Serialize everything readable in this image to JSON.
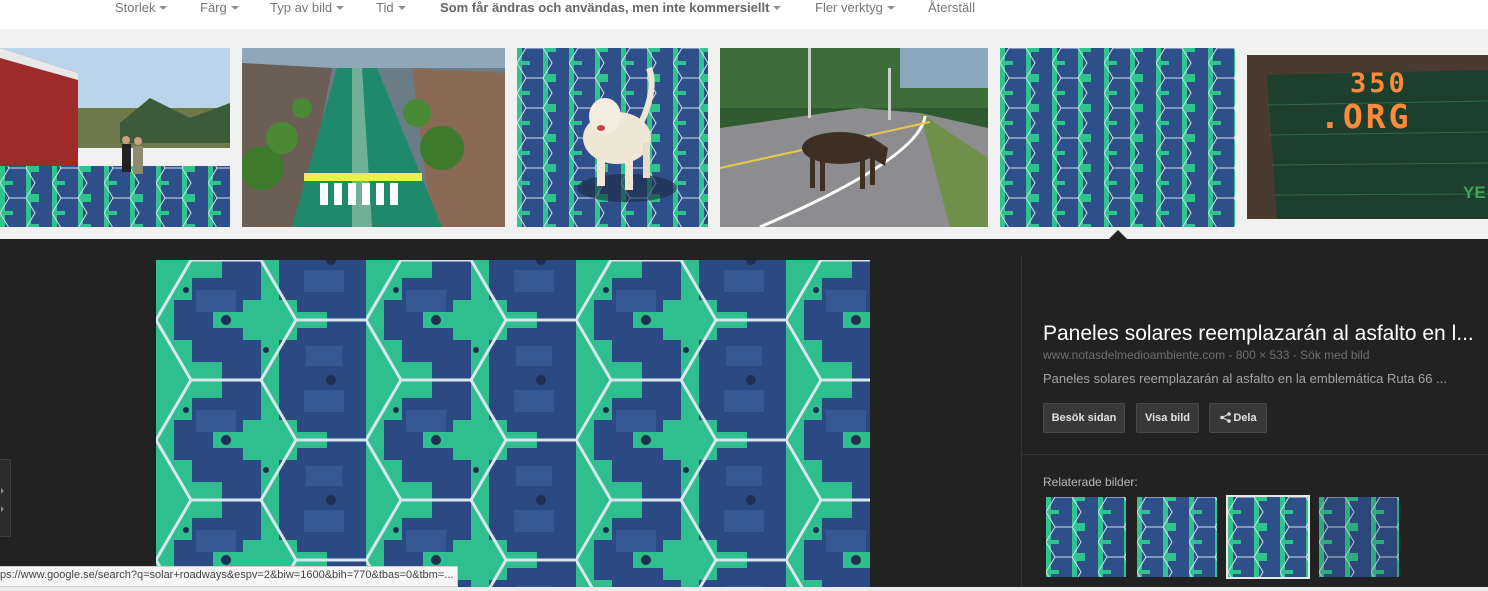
{
  "toolbar": {
    "tools": [
      {
        "label": "Storlek",
        "dropdown": true
      },
      {
        "label": "Färg",
        "dropdown": true
      },
      {
        "label": "Typ av bild",
        "dropdown": true
      },
      {
        "label": "Tid",
        "dropdown": true
      },
      {
        "label": "Som får ändras och användas, men inte kommersiellt",
        "dropdown": true,
        "bold": true
      },
      {
        "label": "Fler verktyg",
        "dropdown": true
      },
      {
        "label": "Återställ",
        "dropdown": false
      }
    ]
  },
  "thumbnails": [
    {
      "subject": "red building with solar floor and couple"
    },
    {
      "subject": "aerial view of solar road with crosswalk"
    },
    {
      "subject": "white dog walking on solar panels"
    },
    {
      "subject": "moose crossing road"
    },
    {
      "subject": "solar hexagon panels close-up",
      "selected": true
    },
    {
      "subject": "350.ORG led solar panel",
      "text_top": "350",
      "text_bottom": ".ORG",
      "corner_text": "YE"
    }
  ],
  "panel": {
    "title": "Paneles solares reemplazarán al asfalto en l...",
    "meta": "www.notasdelmedioambiente.com - 800 × 533 - Sök med bild",
    "description": "Paneles solares reemplazarán al asfalto en la emblemática Ruta 66 ...",
    "buttons": {
      "visit": "Besök sidan",
      "view": "Visa bild",
      "share": "Dela"
    },
    "related_label": "Relaterade bilder:",
    "related_images": [
      {
        "subject": "solar hexagons"
      },
      {
        "subject": "solar hexagons"
      },
      {
        "subject": "solar hexagons",
        "selected": true
      },
      {
        "subject": "solar hexagons"
      }
    ]
  },
  "status_bar": {
    "url": "ps://www.google.se/search?q=solar+roadways&espv=2&biw=1600&bih=770&tbas=0&tbm=..."
  },
  "colors": {
    "panel_bg": "#222222",
    "panel_green": "#2fc48d",
    "panel_blue": "#2f4d86",
    "toolbar_text": "#777777"
  },
  "icons": [
    "share-icon",
    "chevron-down-icon",
    "next-arrow-icon"
  ]
}
